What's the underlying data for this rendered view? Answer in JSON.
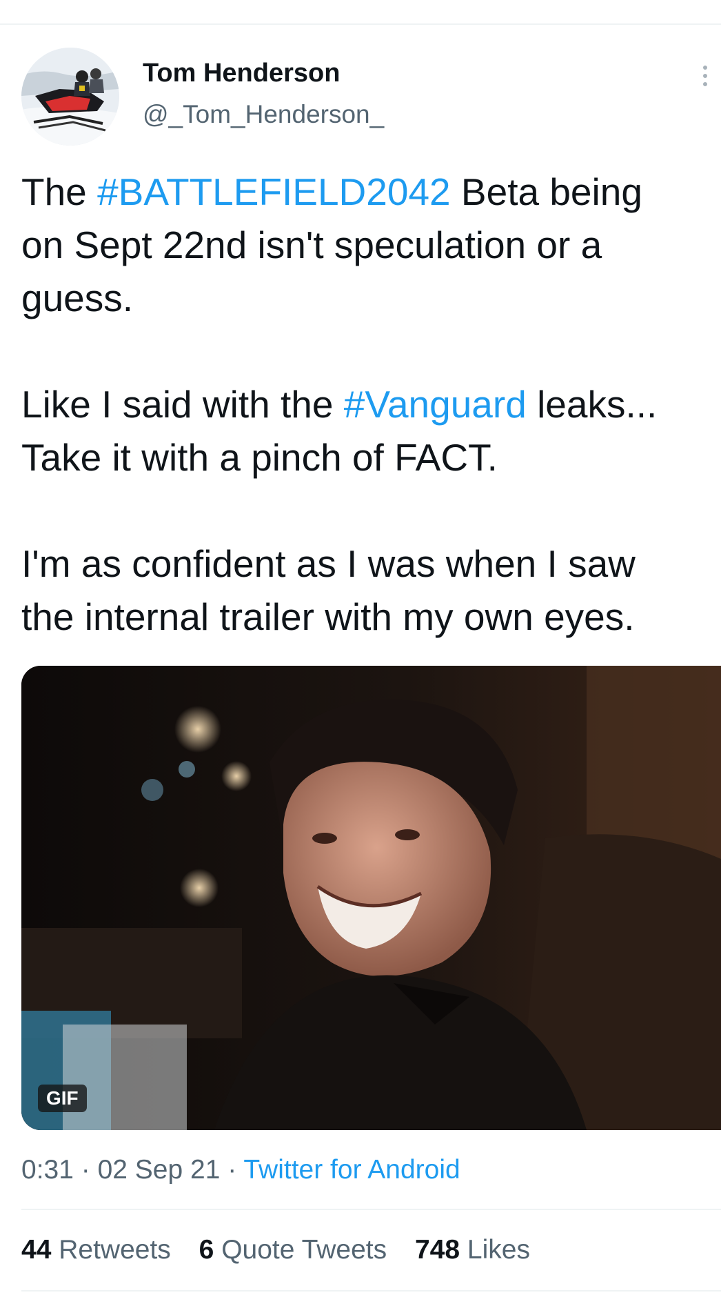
{
  "user": {
    "display_name": "Tom Henderson",
    "handle": "@_Tom_Henderson_",
    "avatar_icon": "snowmobile-avatar-photo"
  },
  "tweet": {
    "p1": {
      "l1": {
        "a": "The ",
        "tag": "#BATTLEFIELD2042",
        "b": " Beta being"
      },
      "l2": "on Sept 22nd isn't speculation or a",
      "l3": "guess."
    },
    "p2": {
      "l1": {
        "a": "Like I said with the ",
        "tag": "#Vanguard",
        "b": " leaks..."
      },
      "l2": "Take it with a pinch of FACT."
    },
    "p3": {
      "l1": "I'm as confident as I was when I saw",
      "l2": "the internal trailer with my own eyes."
    }
  },
  "media": {
    "badge": "GIF",
    "description_icon": "smirking-man-gif"
  },
  "meta": {
    "time": "0:31",
    "sep1": " · ",
    "date": "02 Sep 21",
    "sep2": " · ",
    "source": "Twitter for Android"
  },
  "stats": {
    "retweets_count": "44",
    "retweets_label": "Retweets",
    "quotes_count": "6",
    "quotes_label": "Quote Tweets",
    "likes_count": "748",
    "likes_label": "Likes"
  },
  "colors": {
    "link": "#1d9bf0",
    "text": "#0f1419",
    "secondary": "#536471",
    "divider": "#eff3f4"
  }
}
